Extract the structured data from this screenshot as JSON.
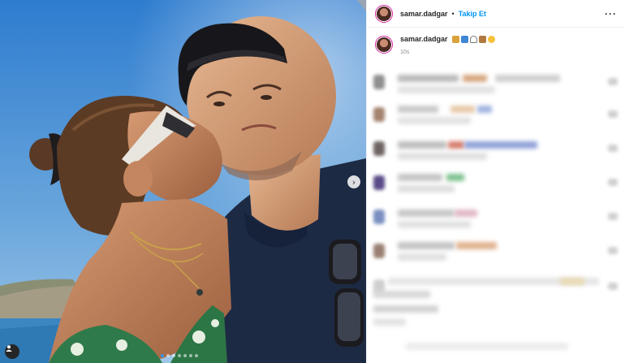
{
  "post": {
    "username": "samar.dadgar",
    "separator": "•",
    "follow_label": "Takip Et",
    "more_label": "···",
    "caption": {
      "username": "samar.dadgar",
      "emojis": [
        "couple-emoji",
        "wave-emoji",
        "white-heart-emoji",
        "teddy-bear-emoji",
        "smiley-emoji"
      ],
      "time": "10s"
    }
  },
  "carousel": {
    "next_icon": "chevron-right-icon",
    "dots": 7,
    "active_dot": 0
  },
  "comments": {
    "count": 9,
    "blurred": true
  },
  "colors": {
    "follow": "#0095f6",
    "sky": "#4a8fd0",
    "shirt": "#1d2a44"
  }
}
